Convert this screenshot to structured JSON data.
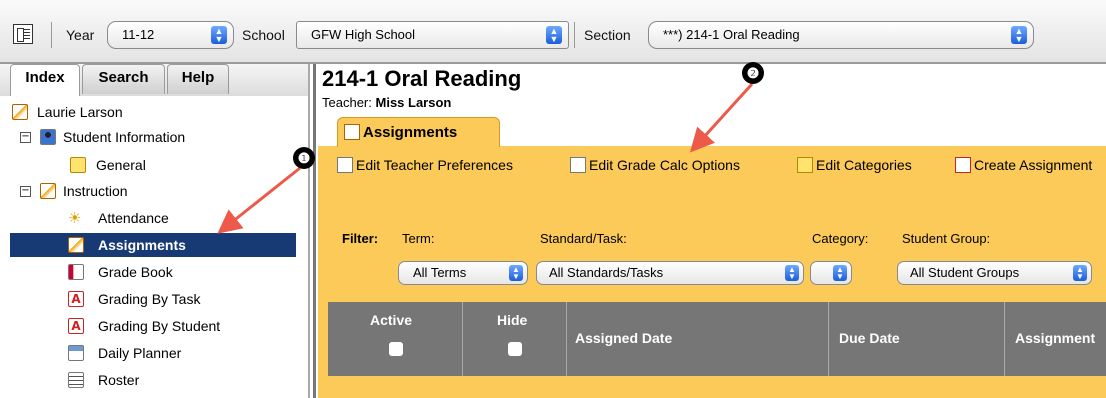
{
  "topbar": {
    "year_label": "Year",
    "year_value": "11-12",
    "school_label": "School",
    "school_value": "GFW High School",
    "section_label": "Section",
    "section_value": "***) 214-1 Oral Reading"
  },
  "left_tabs": [
    "Index",
    "Search",
    "Help"
  ],
  "tree": {
    "user": "Laurie Larson",
    "student_info": "Student Information",
    "general": "General",
    "instruction": "Instruction",
    "items": [
      "Attendance",
      "Assignments",
      "Grade Book",
      "Grading By Task",
      "Grading By Student",
      "Daily Planner",
      "Roster"
    ],
    "selected": "Assignments"
  },
  "main": {
    "title": "214-1 Oral Reading",
    "teacher_label": "Teacher:",
    "teacher_name": "Miss Larson",
    "tab_label": "Assignments",
    "actions": [
      "Edit Teacher Preferences",
      "Edit Grade Calc Options",
      "Edit Categories",
      "Create Assignment"
    ],
    "filter": {
      "label": "Filter:",
      "term_label": "Term:",
      "standard_label": "Standard/Task:",
      "category_label": "Category:",
      "group_label": "Student Group:",
      "term_value": "All Terms",
      "standard_value": "All Standards/Tasks",
      "category_value": "",
      "group_value": "All Student Groups"
    },
    "columns": [
      "Active",
      "Hide",
      "Assigned Date",
      "Due Date",
      "Assignment"
    ]
  },
  "callouts": [
    "❶",
    "❷"
  ],
  "colors": {
    "accent": "#fbca58",
    "selected": "#173a75",
    "header": "#767676",
    "callout_arrow": "#ee5a4a"
  }
}
